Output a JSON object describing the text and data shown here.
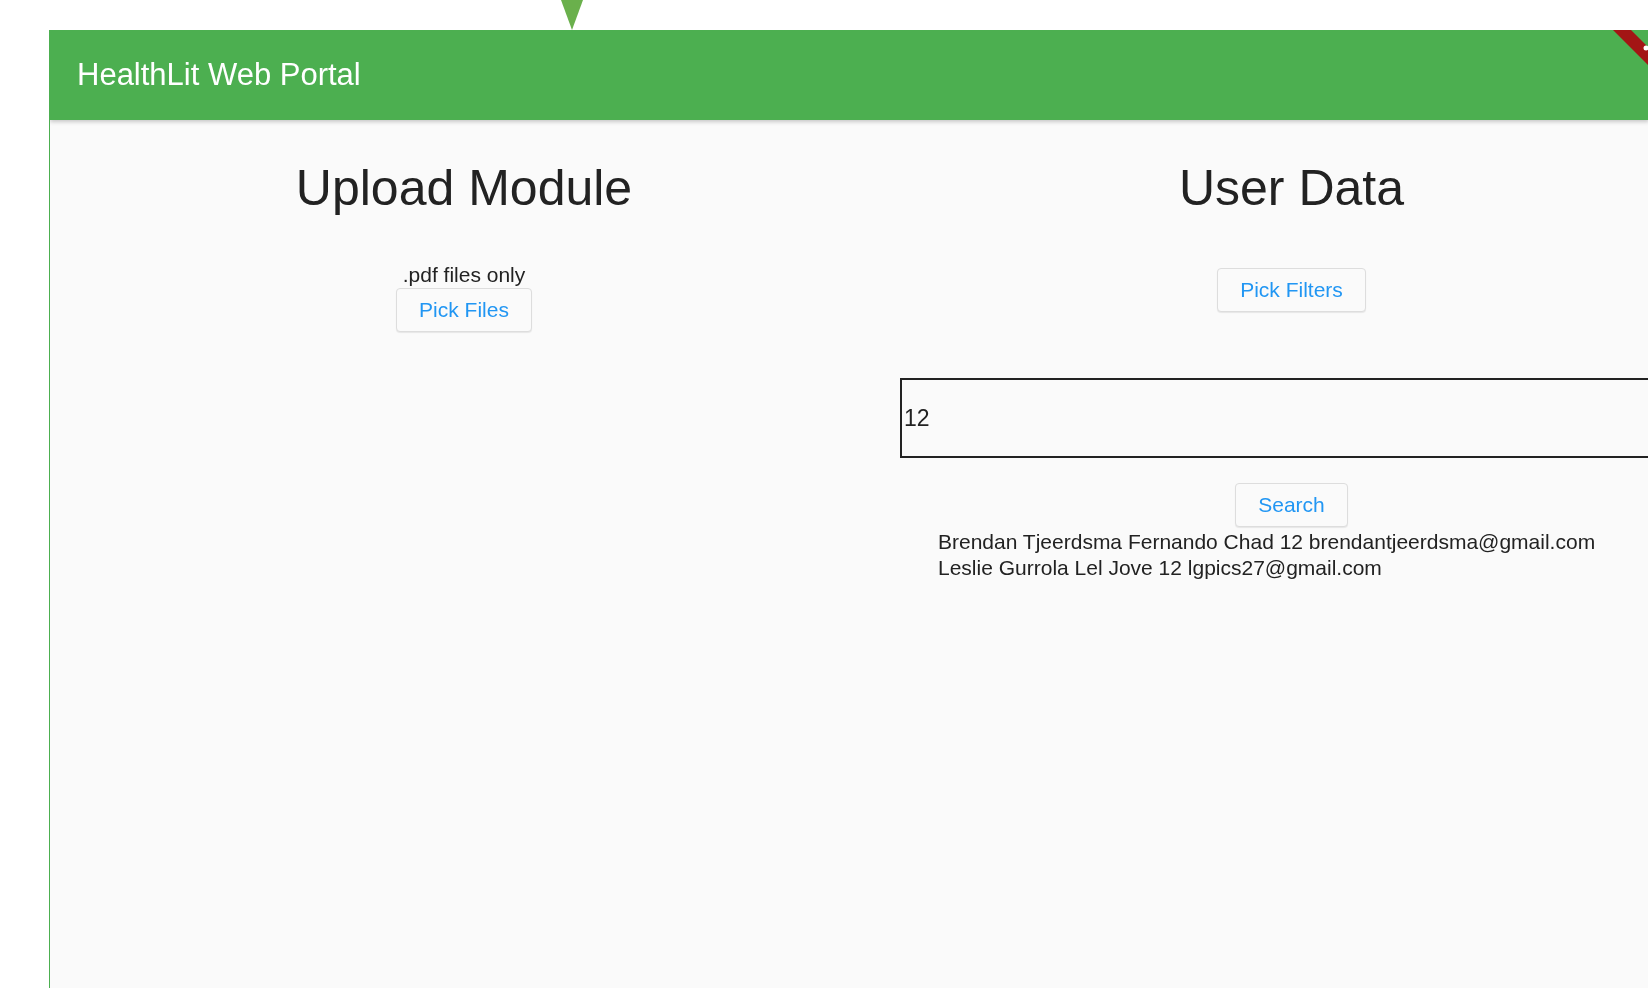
{
  "app_bar": {
    "title": "HealthLit Web Portal"
  },
  "upload": {
    "heading": "Upload Module",
    "hint": ".pdf files only",
    "button": "Pick Files"
  },
  "user_data": {
    "heading": "User Data",
    "filter_button": "Pick Filters",
    "search_field": {
      "value": "12"
    },
    "search_button": "Search",
    "results": [
      "Brendan Tjeerdsma Fernando Chad 12 brendantjeerdsma@gmail.com",
      "Leslie Gurrola Lel Jove 12 lgpics27@gmail.com"
    ]
  }
}
